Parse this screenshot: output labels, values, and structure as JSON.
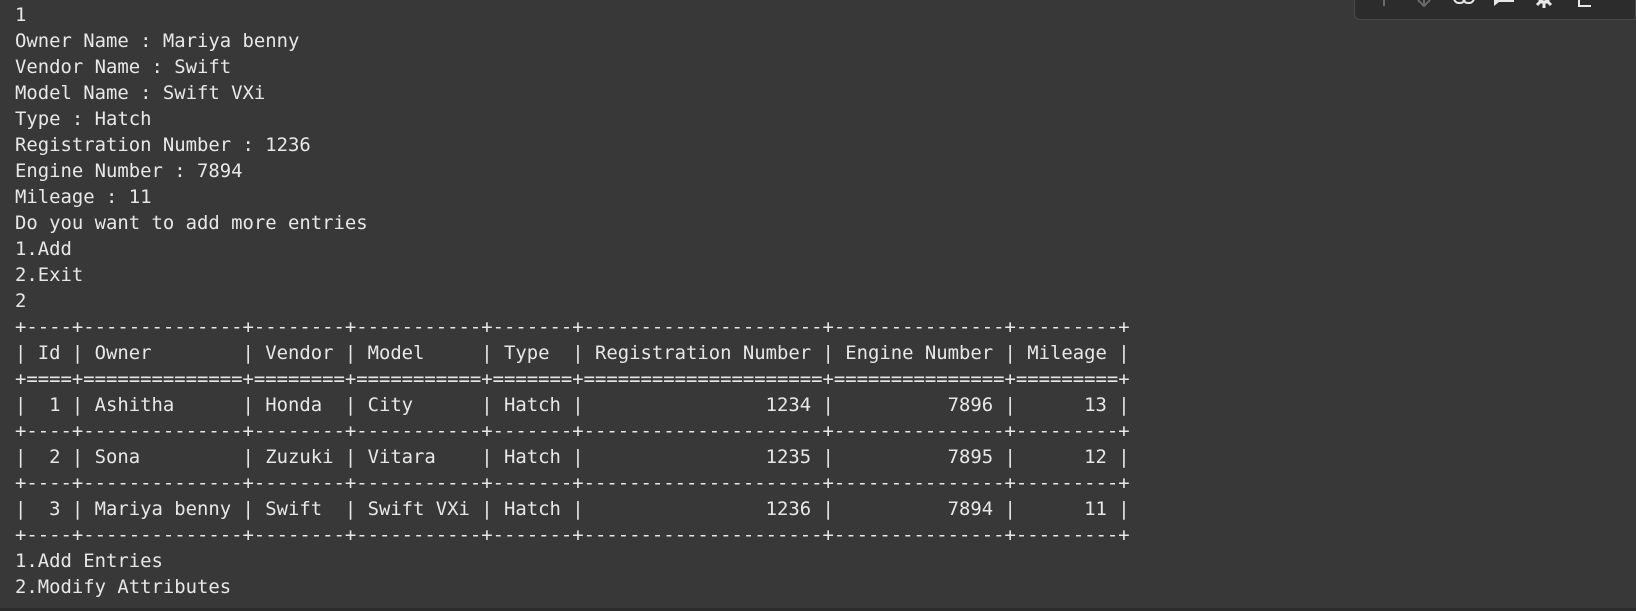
{
  "output_lines": [
    "1",
    "Owner Name : Mariya benny",
    "Vendor Name : Swift",
    "Model Name : Swift VXi",
    "Type : Hatch",
    "Registration Number : 1236",
    "Engine Number : 7894",
    "Mileage : 11",
    "Do you want to add more entries",
    "1.Add",
    "2.Exit",
    "2"
  ],
  "table": {
    "columns": [
      "Id",
      "Owner",
      "Vendor",
      "Model",
      "Type",
      "Registration Number",
      "Engine Number",
      "Mileage"
    ],
    "rows": [
      [
        "1",
        "Ashitha",
        "Honda",
        "City",
        "Hatch",
        "1234",
        "7896",
        "13"
      ],
      [
        "2",
        "Sona",
        "Zuzuki",
        "Vitara",
        "Hatch",
        "1235",
        "7895",
        "12"
      ],
      [
        "3",
        "Mariya benny",
        "Swift",
        "Swift VXi",
        "Hatch",
        "1236",
        "7894",
        "11"
      ]
    ]
  },
  "menu_lines": [
    "1.Add Entries",
    "2.Modify Attributes"
  ],
  "toolbar": {
    "icons": [
      "arrow-up-icon",
      "arrow-down-icon",
      "link-icon",
      "comment-icon",
      "gear-icon",
      "copy-icon"
    ]
  }
}
